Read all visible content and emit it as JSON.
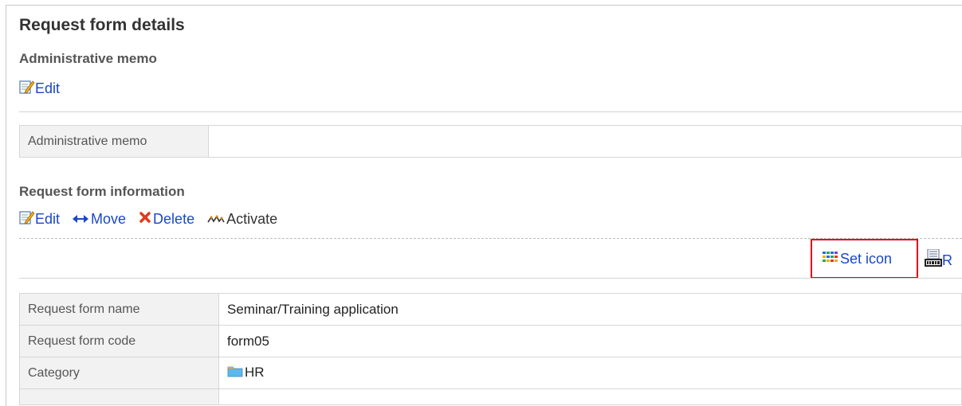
{
  "page": {
    "title": "Request form details"
  },
  "admin_memo": {
    "heading": "Administrative memo",
    "edit_label": "Edit",
    "table_label": "Administrative memo",
    "table_value": ""
  },
  "request_info": {
    "heading": "Request form information",
    "actions": {
      "edit": "Edit",
      "move": "Move",
      "delete": "Delete",
      "activate": "Activate"
    },
    "set_icon_label": "Set icon",
    "r_label": "R"
  },
  "details": {
    "rows": [
      {
        "label": "Request form name",
        "value": "Seminar/Training application"
      },
      {
        "label": "Request form code",
        "value": "form05"
      },
      {
        "label": "Category",
        "value": "HR"
      }
    ]
  },
  "colors": {
    "link": "#1a47c8",
    "highlight_border": "#e0001b",
    "label_bg": "#f2f2f2"
  }
}
